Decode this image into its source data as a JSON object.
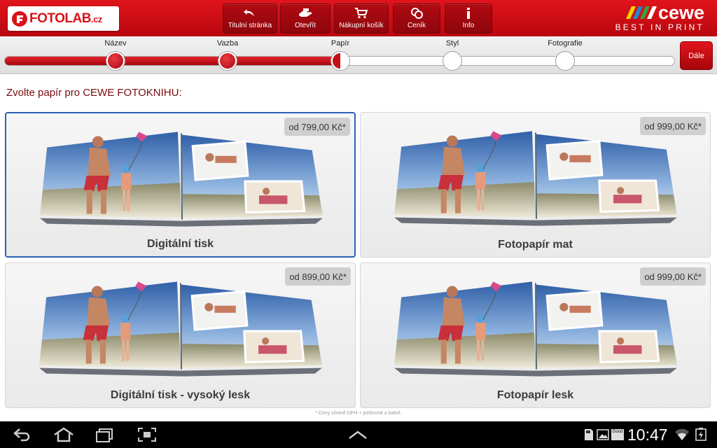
{
  "header": {
    "brand": {
      "name": "FOTOLAB",
      "domain": ".cz",
      "color": "#d8121a"
    },
    "nav": [
      {
        "id": "home",
        "label": "Titulní stránka",
        "icon": "home-arrow-icon"
      },
      {
        "id": "open",
        "label": "Otevřít",
        "icon": "open-hand-icon"
      },
      {
        "id": "cart",
        "label": "Nákupní košík",
        "icon": "cart-icon"
      },
      {
        "id": "prices",
        "label": "Ceník",
        "icon": "coins-icon"
      },
      {
        "id": "info",
        "label": "Info",
        "icon": "info-icon"
      }
    ],
    "partner": {
      "name": "cewe",
      "tagline": "BEST IN PRINT"
    }
  },
  "progress": {
    "steps": [
      {
        "label": "Název",
        "state": "done"
      },
      {
        "label": "Vazba",
        "state": "done"
      },
      {
        "label": "Papír",
        "state": "current"
      },
      {
        "label": "Styl",
        "state": "todo"
      },
      {
        "label": "Fotografie",
        "state": "todo"
      }
    ],
    "next_label": "Dále",
    "accent": "#c40f17"
  },
  "main": {
    "heading": "Zvolte papír pro CEWE FOTOKNIHU:",
    "options": [
      {
        "name": "Digitální tisk",
        "price": "od 799,00 Kč*",
        "selected": true
      },
      {
        "name": "Fotopapír mat",
        "price": "od 999,00 Kč*",
        "selected": false
      },
      {
        "name": "Digitální tisk - vysoký lesk",
        "price": "od 899,00 Kč*",
        "selected": false
      },
      {
        "name": "Fotopapír lesk",
        "price": "od 999,00 Kč*",
        "selected": false
      }
    ],
    "footnote": "* Ceny včetně DPH + poštovné a balné."
  },
  "system_bar": {
    "clock": "10:47",
    "widget_text": "Good"
  }
}
